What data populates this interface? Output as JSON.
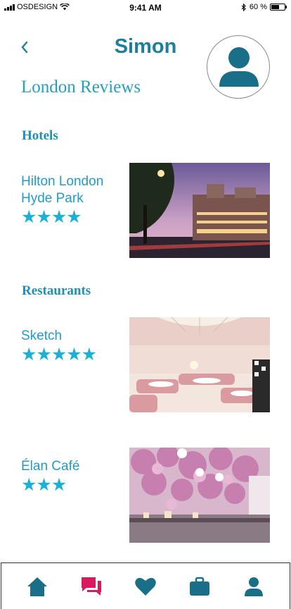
{
  "status_bar": {
    "carrier": "OSDESIGN",
    "time": "9:41 AM",
    "battery": "60 %"
  },
  "header": {
    "title": "Simon",
    "subtitle": "London Reviews"
  },
  "sections": {
    "hotels": {
      "heading": "Hotels",
      "items": [
        {
          "name_line1": "Hilton London",
          "name_line2": "Hyde Park",
          "stars": "★★★★",
          "rating": 4
        }
      ]
    },
    "restaurants": {
      "heading": "Restaurants",
      "items": [
        {
          "name": "Sketch",
          "stars": "★★★★★",
          "rating": 5
        },
        {
          "name": "Élan Café",
          "stars": "★★★",
          "rating": 3
        }
      ]
    }
  },
  "tabbar": {
    "items": [
      "home-icon",
      "chat-icon",
      "heart-icon",
      "briefcase-icon",
      "profile-icon"
    ],
    "active": "chat-icon"
  },
  "colors": {
    "accent": "#1f9ccc",
    "title": "#1c7f9c",
    "icon": "#1a6f88",
    "active_tab": "#d81b60"
  }
}
